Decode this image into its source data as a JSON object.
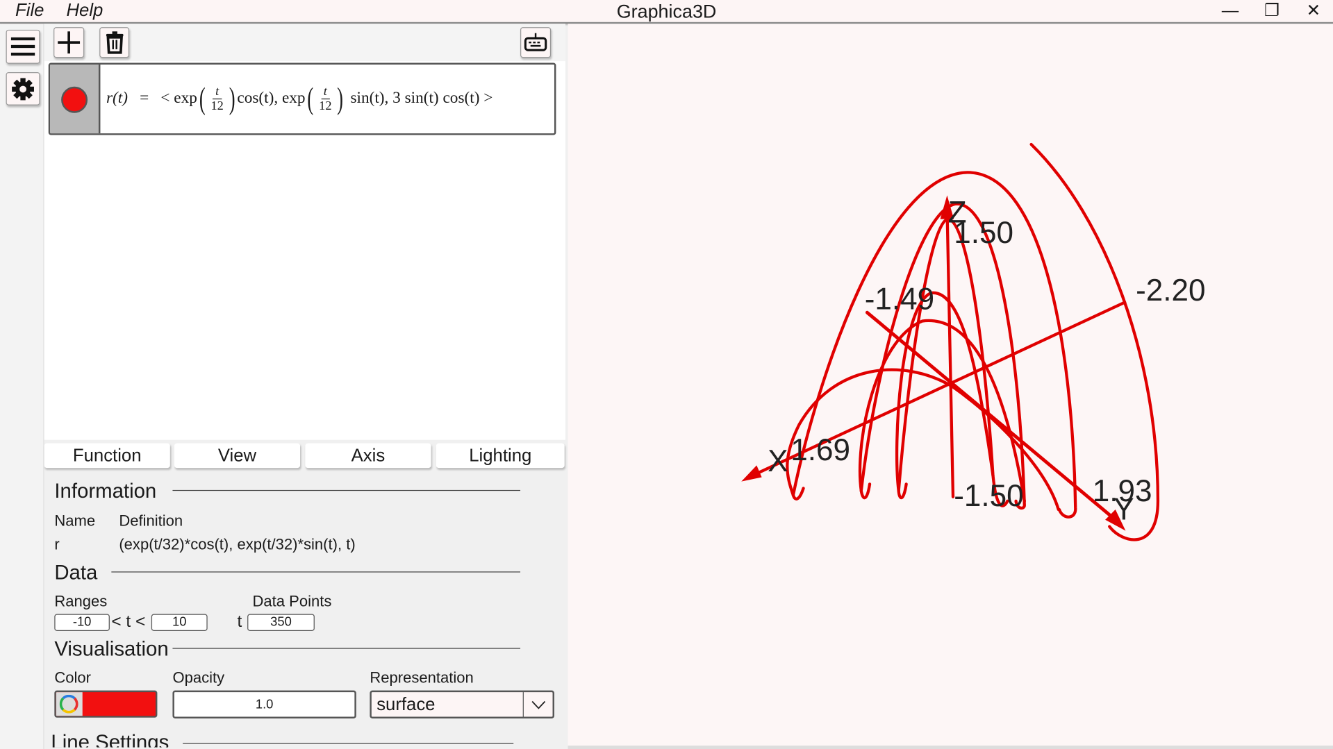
{
  "app": {
    "title": "Graphica3D",
    "menu": [
      "File",
      "Help"
    ]
  },
  "window_controls": {
    "minimize": "—",
    "maximize": "❐",
    "close": "✕"
  },
  "sidebar": {
    "icons": [
      "menu-icon",
      "gear-icon"
    ]
  },
  "toolbar": {
    "add_icon": "plus-icon",
    "delete_icon": "trash-icon",
    "keyboard_icon": "keyboard-icon"
  },
  "function_item": {
    "color": "#f21010",
    "lhs": "r(t)",
    "eq": "=",
    "p1": "< exp",
    "num": "t",
    "den": "12",
    "p2": "cos(t), exp",
    "p3": "sin(t), 3 sin(t) cos(t) >"
  },
  "tabs": [
    "Function",
    "View",
    "Axis",
    "Lighting"
  ],
  "information": {
    "heading": "Information",
    "name_label": "Name",
    "definition_label": "Definition",
    "name": "r",
    "definition": "(exp(t/32)*cos(t), exp(t/32)*sin(t), t)"
  },
  "data": {
    "heading": "Data",
    "ranges_label": "Ranges",
    "range_min": "-10",
    "range_sep": "< t <",
    "range_max": "10",
    "points_label": "Data Points",
    "points_var": "t",
    "points": "350"
  },
  "visualisation": {
    "heading": "Visualisation",
    "color_label": "Color",
    "color": "#f21010",
    "opacity_label": "Opacity",
    "opacity": "1.0",
    "representation_label": "Representation",
    "representation": "surface"
  },
  "line_settings": {
    "heading": "Line Settings"
  },
  "plot": {
    "curve_color": "#e00000",
    "labels": {
      "z_axis": "Z",
      "z_max": "1.50",
      "z_min": "-1.50",
      "y_min": "-1.49",
      "x_min": "-2.20",
      "x_axis": "X",
      "x_max": "1.69",
      "y_max": "1.93",
      "y_axis": "Y"
    }
  }
}
